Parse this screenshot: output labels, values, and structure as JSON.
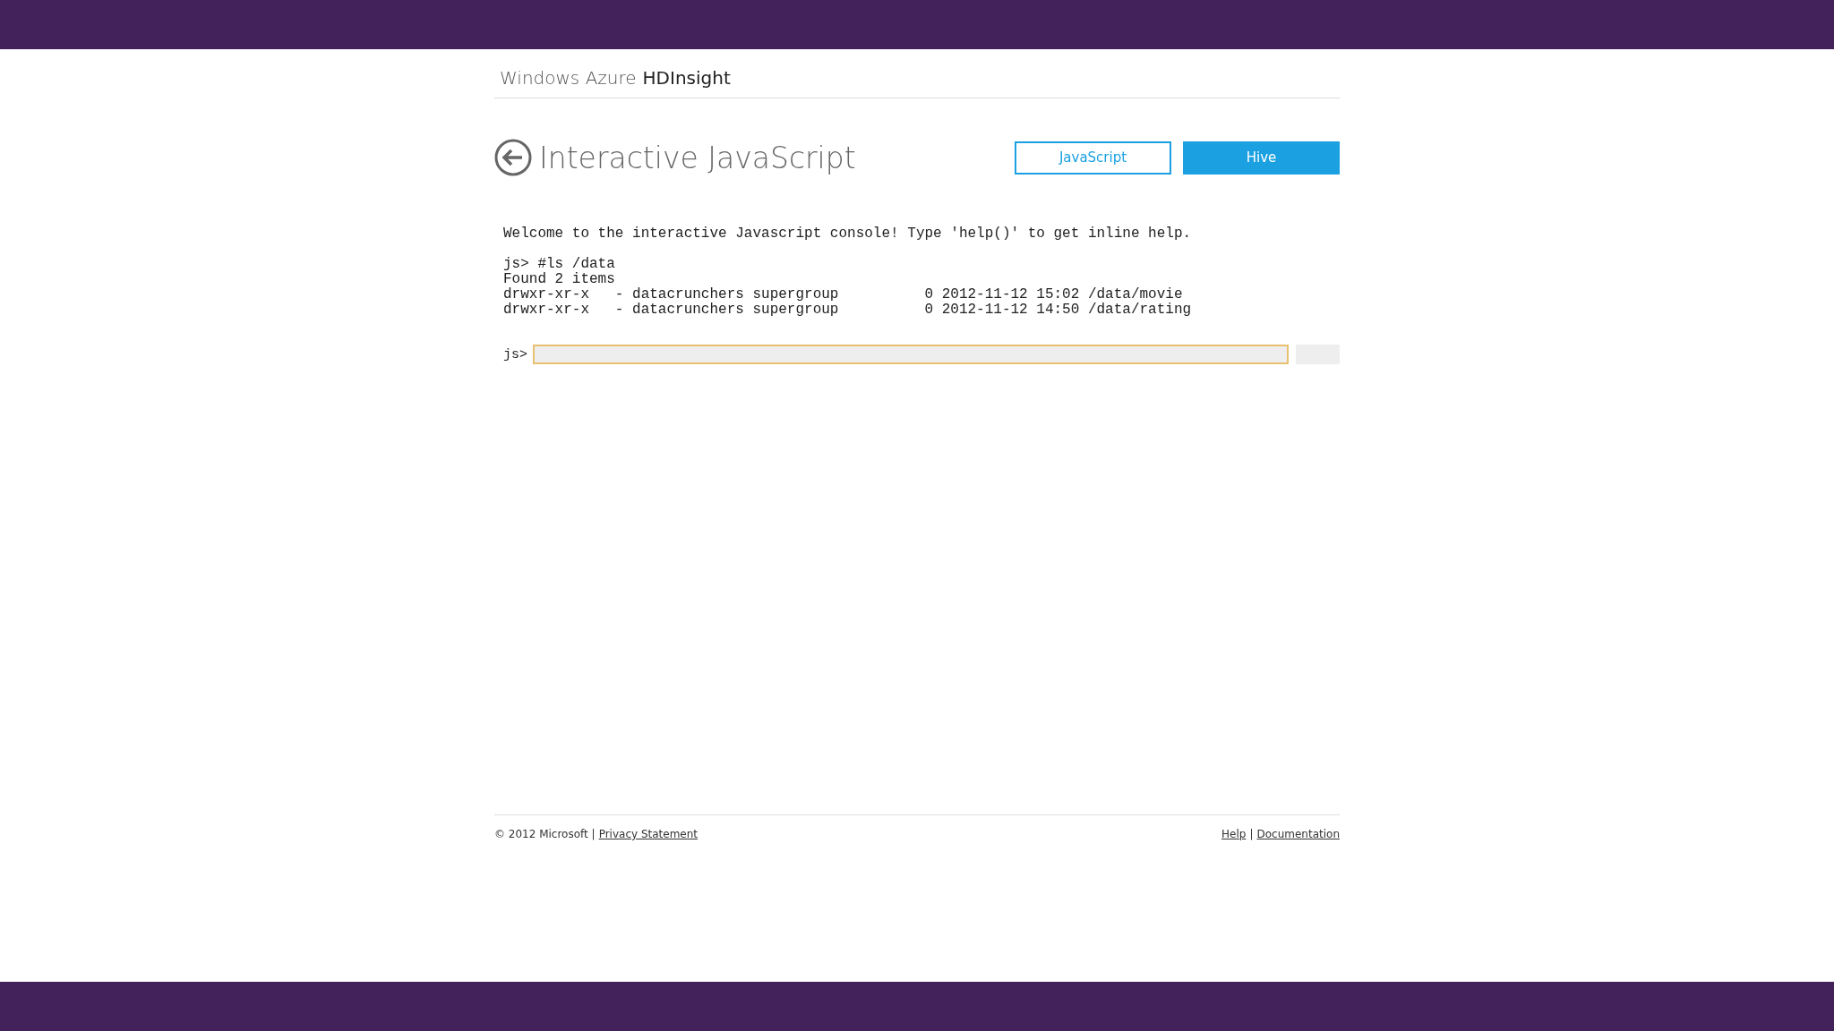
{
  "brand": {
    "prefix": "Windows Azure",
    "product": "HDInsight"
  },
  "page": {
    "title": "Interactive JavaScript"
  },
  "tabs": [
    {
      "label": "JavaScript",
      "selected": true
    },
    {
      "label": "Hive",
      "selected": false
    }
  ],
  "console": {
    "welcome": "Welcome to the interactive Javascript console! Type 'help()' to get inline help.",
    "lines": [
      "js> #ls /data",
      "Found 2 items",
      "drwxr-xr-x   - datacrunchers supergroup          0 2012-11-12 15:02 /data/movie",
      "drwxr-xr-x   - datacrunchers supergroup          0 2012-11-12 14:50 /data/rating"
    ],
    "prompt": "js>"
  },
  "footer": {
    "copyright": "© 2012 Microsoft |",
    "left_links": [
      "Privacy Statement"
    ],
    "right_links": [
      "Help",
      "Documentation"
    ],
    "separator": "|"
  }
}
